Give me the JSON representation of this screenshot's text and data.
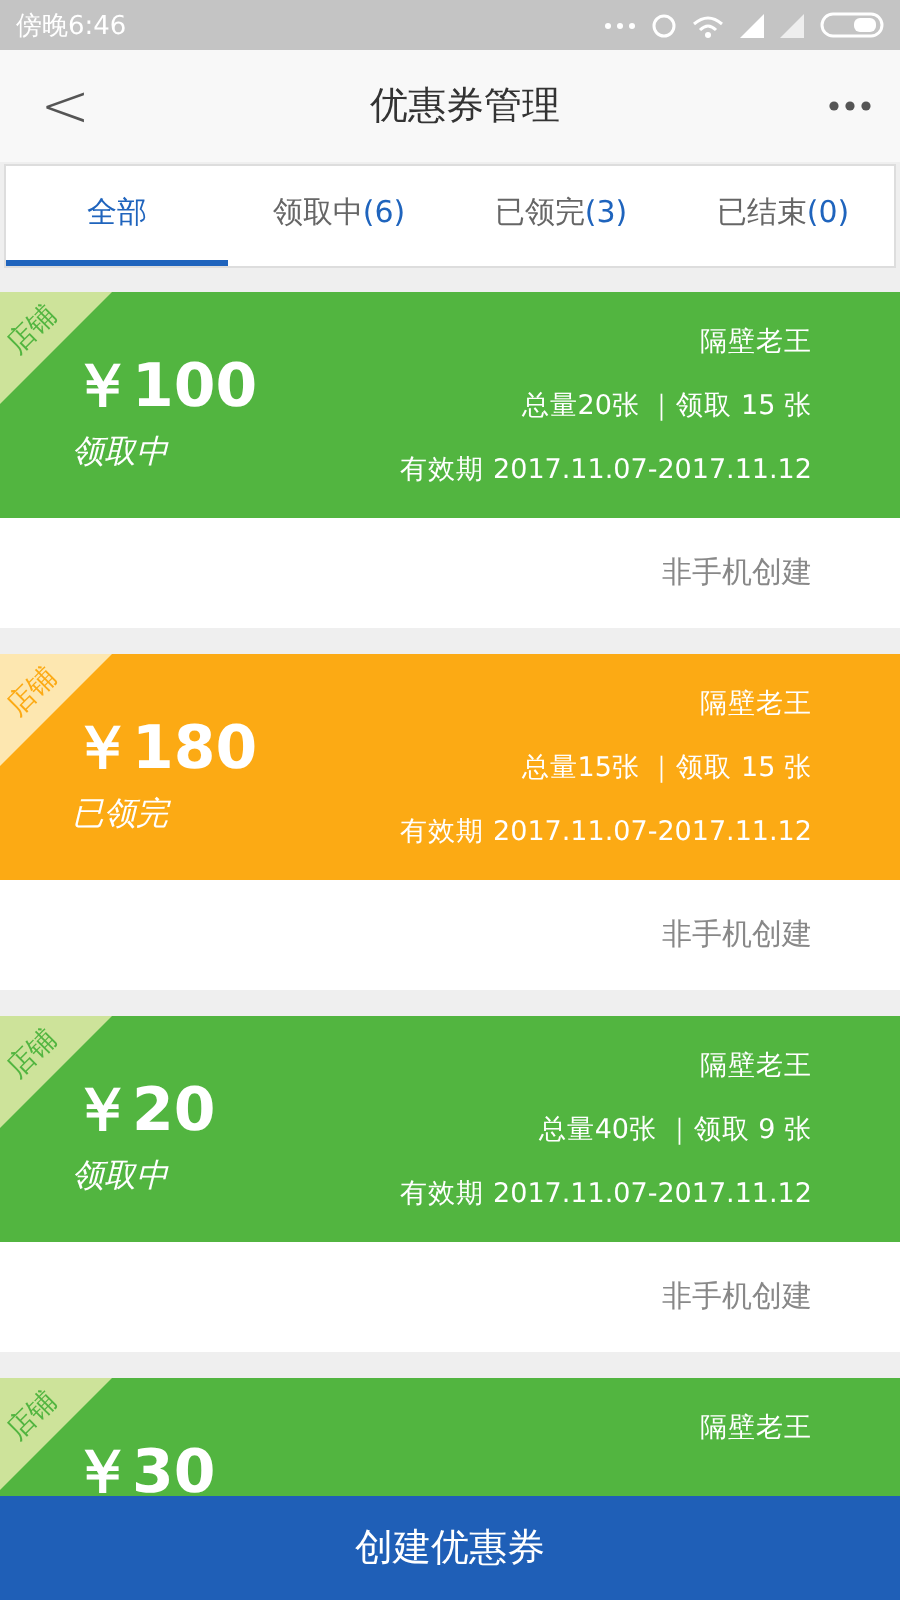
{
  "status_bar": {
    "time": "傍晚6:46"
  },
  "header": {
    "back": "<",
    "title": "优惠券管理"
  },
  "tabs": [
    {
      "label": "全部",
      "selected": true
    },
    {
      "label": "领取中",
      "count": "(6)",
      "selected": false
    },
    {
      "label": "已领完",
      "count": "(3)",
      "selected": false
    },
    {
      "label": "已结束",
      "count": "(0)",
      "selected": false
    }
  ],
  "coupons": [
    {
      "kind": "active",
      "tag": "店铺",
      "amount": "￥100",
      "status": "领取中",
      "shop": "隔壁老王",
      "stats": "总量20张 ｜领取 15 张",
      "validity": "有效期 2017.11.07-2017.11.12",
      "source": "非手机创建"
    },
    {
      "kind": "finished",
      "tag": "店铺",
      "amount": "￥180",
      "status": "已领完",
      "shop": "隔壁老王",
      "stats": "总量15张 ｜领取 15 张",
      "validity": "有效期 2017.11.07-2017.11.12",
      "source": "非手机创建"
    },
    {
      "kind": "active",
      "tag": "店铺",
      "amount": "￥20",
      "status": "领取中",
      "shop": "隔壁老王",
      "stats": "总量40张 ｜领取 9 张",
      "validity": "有效期 2017.11.07-2017.11.12",
      "source": "非手机创建"
    },
    {
      "kind": "active",
      "tag": "店铺",
      "amount": "￥30",
      "shop": "隔壁老王"
    }
  ],
  "create_button": "创建优惠券"
}
